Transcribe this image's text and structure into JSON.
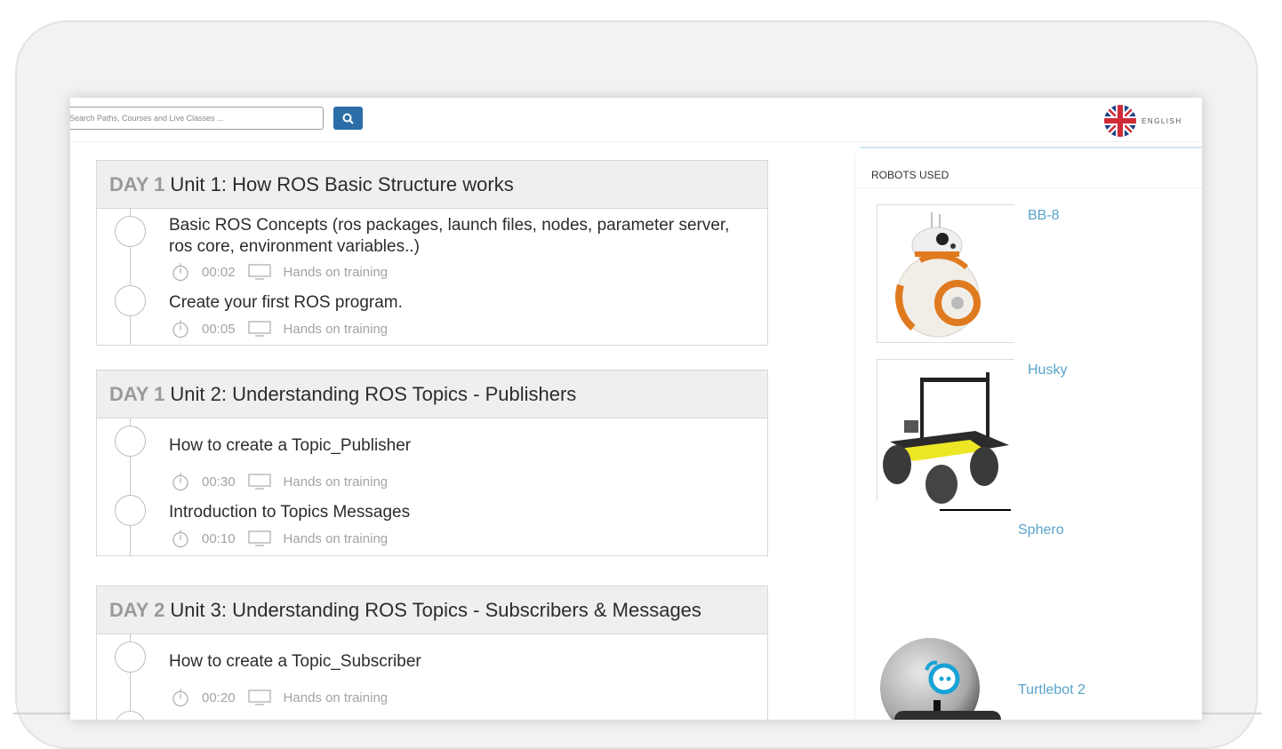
{
  "search": {
    "placeholder": "Search Paths, Courses and Live Classes ..."
  },
  "header": {
    "language_label": "ENGLISH"
  },
  "units": [
    {
      "day": "DAY 1",
      "title": "Unit 1: How ROS Basic Structure works",
      "lessons": [
        {
          "title": "Basic ROS Concepts (ros packages, launch files, nodes, parameter server, ros core, environment variables..)",
          "duration": "00:02",
          "type": "Hands on training"
        },
        {
          "title": "Create your first ROS program.",
          "duration": "00:05",
          "type": "Hands on training"
        }
      ]
    },
    {
      "day": "DAY 1",
      "title": "Unit 2: Understanding ROS Topics - Publishers",
      "lessons": [
        {
          "title": "How to create a Topic_Publisher",
          "duration": "00:30",
          "type": "Hands on training"
        },
        {
          "title": "Introduction to Topics Messages",
          "duration": "00:10",
          "type": "Hands on training"
        }
      ]
    },
    {
      "day": "DAY 2",
      "title": "Unit 3: Understanding ROS Topics - Subscribers & Messages",
      "lessons": [
        {
          "title": "How to create a Topic_Subscriber",
          "duration": "00:20",
          "type": "Hands on training"
        }
      ]
    }
  ],
  "sidebar": {
    "heading": "ROBOTS USED",
    "robots": [
      {
        "name": "BB-8"
      },
      {
        "name": "Husky"
      },
      {
        "name": "Sphero"
      },
      {
        "name": "Turtlebot 2"
      }
    ]
  },
  "colors": {
    "accent": "#2b6ea7",
    "link": "#58a3c9",
    "day": "#9a9a9a"
  }
}
